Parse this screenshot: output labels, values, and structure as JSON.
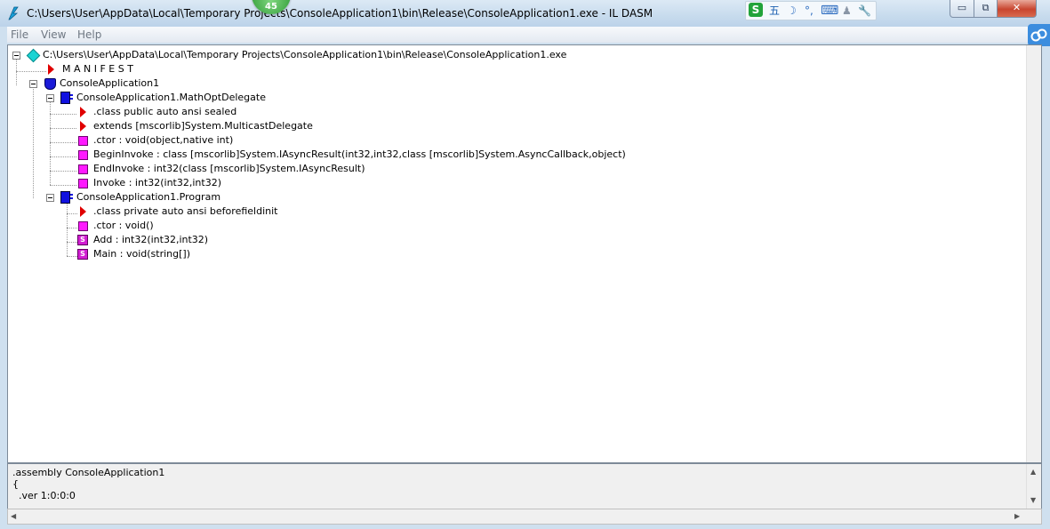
{
  "window": {
    "title": "C:\\Users\\User\\AppData\\Local\\Temporary Projects\\ConsoleApplication1\\bin\\Release\\ConsoleApplication1.exe - IL DASM",
    "badge": "45",
    "minimize_glyph": "▭",
    "maximize_glyph": "⧉",
    "close_glyph": "✕"
  },
  "ime": {
    "logo": "S",
    "mode": "五",
    "moon": "☽",
    "punct": "°,",
    "keyboard": "⌨",
    "user": "♟",
    "tool": "🔧"
  },
  "menu": {
    "file": "File",
    "view": "View",
    "help": "Help"
  },
  "tree": {
    "root": "C:\\Users\\User\\AppData\\Local\\Temporary Projects\\ConsoleApplication1\\bin\\Release\\ConsoleApplication1.exe",
    "manifest": "M A N I F E S T",
    "namespace": "ConsoleApplication1",
    "class1": "ConsoleApplication1.MathOptDelegate",
    "class1_items": [
      ".class public auto ansi sealed",
      " extends [mscorlib]System.MulticastDelegate",
      ".ctor : void(object,native int)",
      "BeginInvoke : class [mscorlib]System.IAsyncResult(int32,int32,class [mscorlib]System.AsyncCallback,object)",
      "EndInvoke : int32(class [mscorlib]System.IAsyncResult)",
      "Invoke : int32(int32,int32)"
    ],
    "class2": "ConsoleApplication1.Program",
    "class2_items": [
      ".class private auto ansi beforefieldinit",
      ".ctor : void()",
      "Add : int32(int32,int32)",
      "Main : void(string[])"
    ],
    "static_glyph": "S"
  },
  "detail": {
    "lines": [
      ".assembly ConsoleApplication1",
      "{",
      "  .ver 1:0:0:0"
    ]
  },
  "colors": {
    "title_bar": "#c7dbed",
    "class_icon": "#1010e0",
    "method_icon": "#ff19ff",
    "marker_icon": "#e00000"
  },
  "scroll": {
    "up": "▲",
    "down": "▼",
    "left": "◀",
    "right": "▶"
  }
}
